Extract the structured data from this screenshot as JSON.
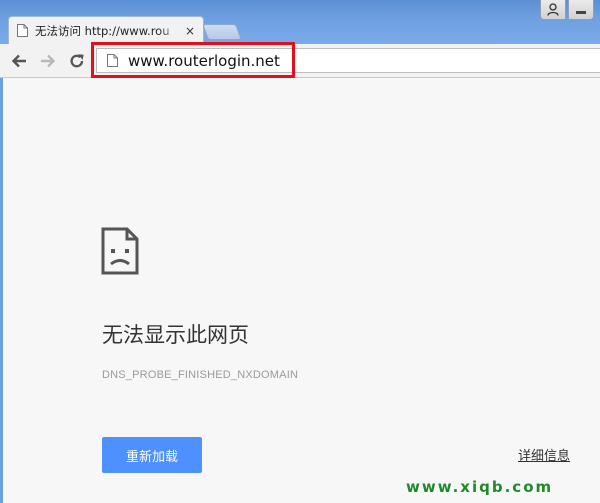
{
  "tab": {
    "title": "无法访问 http://www.rou",
    "close_glyph": "×"
  },
  "toolbar": {
    "back_icon": "back-arrow-icon",
    "forward_icon": "forward-arrow-icon",
    "reload_icon": "reload-icon"
  },
  "omnibox": {
    "url": "www.routerlogin.net"
  },
  "error": {
    "heading": "无法显示此网页",
    "code": "DNS_PROBE_FINISHED_NXDOMAIN",
    "reload_label": "重新加载",
    "details_label": "详细信息"
  },
  "watermark": "www.xiqb.com",
  "colors": {
    "accent_button": "#4d90fe",
    "annotation_box": "#e3101b",
    "watermark": "#1f8a2a"
  }
}
